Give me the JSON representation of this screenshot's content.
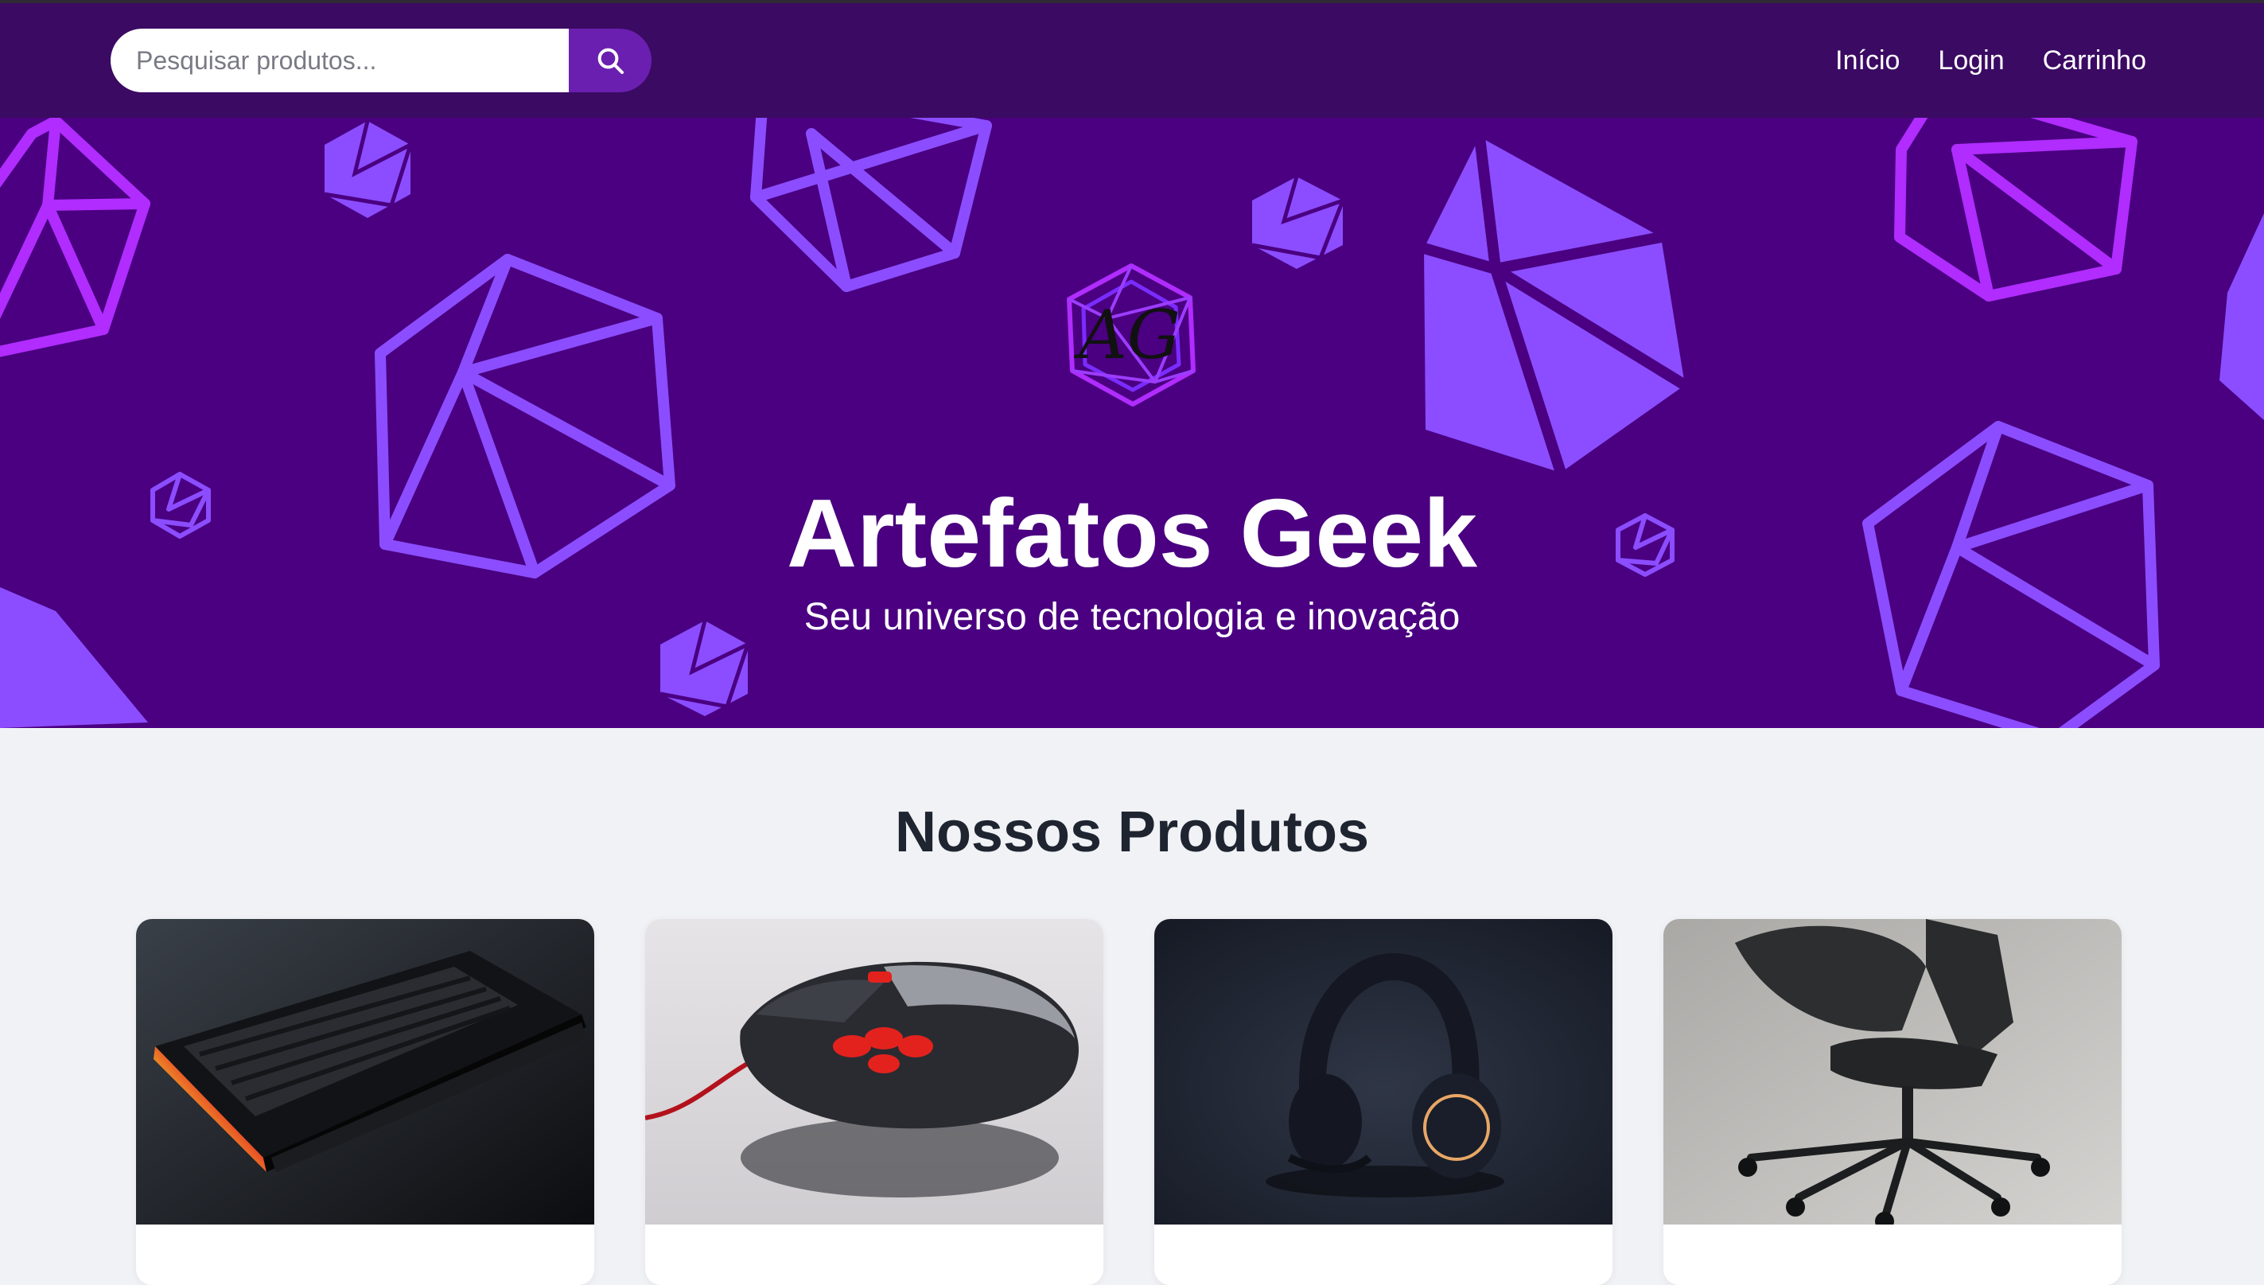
{
  "header": {
    "search": {
      "placeholder": "Pesquisar produtos..."
    },
    "search_icon": "search-icon",
    "nav": [
      {
        "label": "Início"
      },
      {
        "label": "Login"
      },
      {
        "label": "Carrinho"
      }
    ]
  },
  "hero": {
    "logo_text": "AG",
    "title": "Artefatos Geek",
    "subtitle": "Seu universo de tecnologia e inovação"
  },
  "products": {
    "section_title": "Nossos Produtos",
    "items": [
      {
        "image": "rgb-gaming-keyboard-photo"
      },
      {
        "image": "gaming-mouse-photo"
      },
      {
        "image": "gaming-headset-photo"
      },
      {
        "image": "mesh-office-chair-photo"
      }
    ]
  },
  "colors": {
    "header_bg": "#3b0a63",
    "hero_bg": "#4a0080",
    "accent": "#6a1fb0",
    "dice_light": "#8b4dff",
    "dice_magenta": "#b02cff",
    "page_bg": "#f1f2f6"
  }
}
